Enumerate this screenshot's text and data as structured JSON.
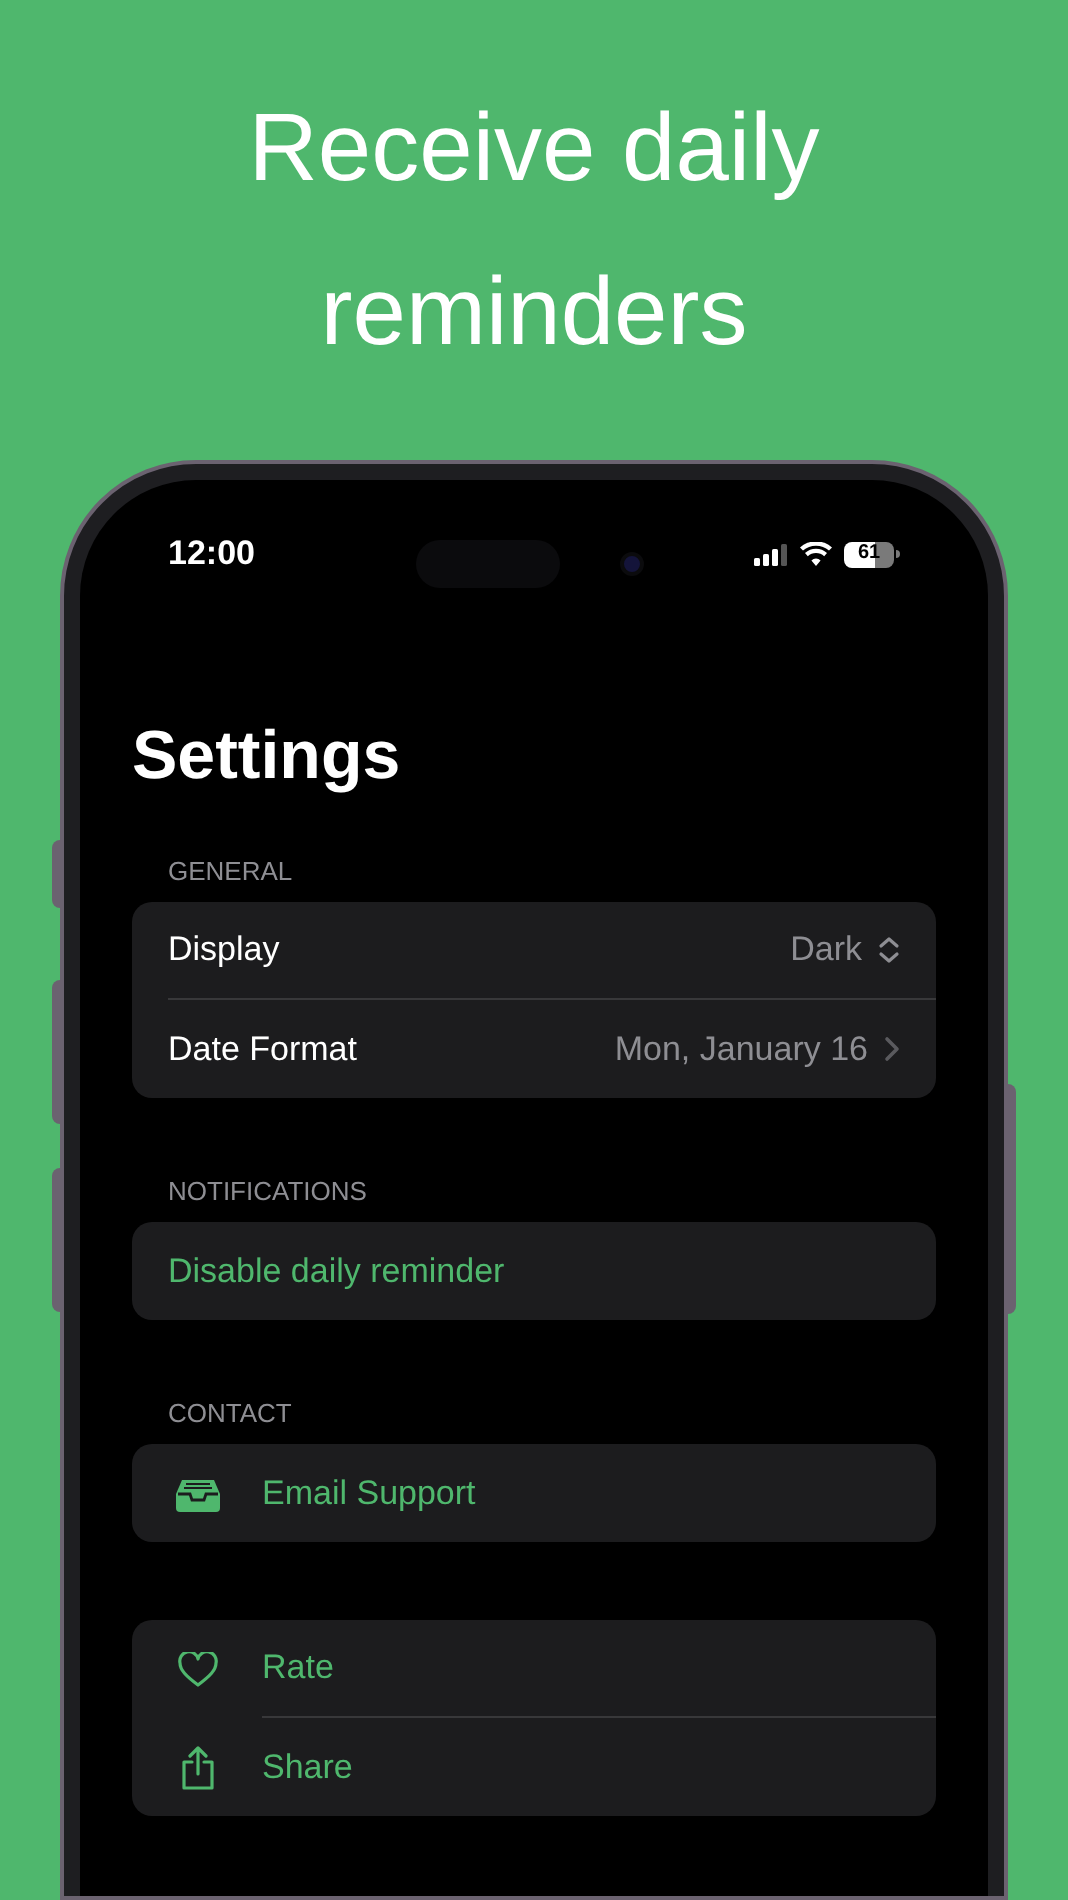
{
  "headline": "Receive daily reminders",
  "status_bar": {
    "time": "12:00",
    "battery": "61"
  },
  "title": "Settings",
  "sections": [
    {
      "header": "GENERAL",
      "rows": [
        {
          "kind": "picker",
          "label": "Display",
          "value": "Dark"
        },
        {
          "kind": "link",
          "label": "Date Format",
          "value": "Mon, January 16"
        }
      ]
    },
    {
      "header": "NOTIFICATIONS",
      "rows": [
        {
          "kind": "action",
          "label": "Disable daily reminder"
        }
      ]
    },
    {
      "header": "CONTACT",
      "rows": [
        {
          "kind": "email",
          "label": "Email Support"
        }
      ]
    },
    {
      "rows": [
        {
          "kind": "rate",
          "label": "Rate"
        },
        {
          "kind": "share",
          "label": "Share"
        }
      ]
    }
  ]
}
